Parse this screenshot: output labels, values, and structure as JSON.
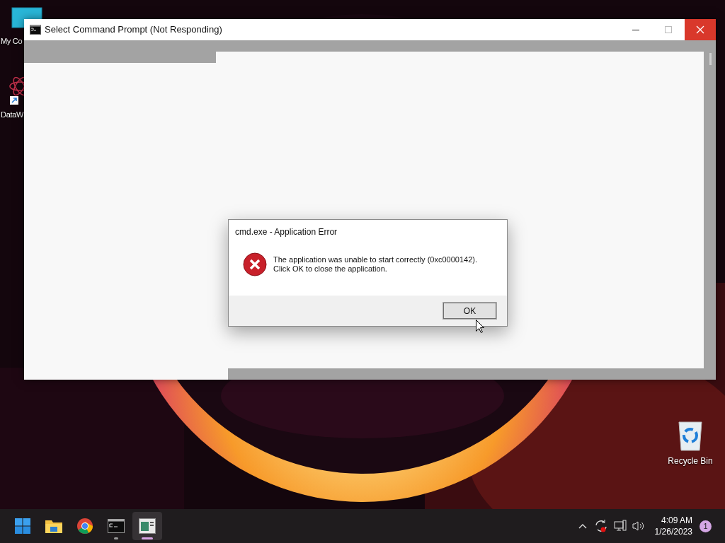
{
  "desktop_icons": [
    {
      "kind": "computer",
      "label": "My Co"
    },
    {
      "kind": "app",
      "label": "DataW"
    },
    {
      "kind": "recycle",
      "label": "Recycle Bin"
    }
  ],
  "window": {
    "title": "Select Command Prompt (Not Responding)"
  },
  "dialog": {
    "title": "cmd.exe - Application Error",
    "message": [
      "The application was unable to start correctly (0xc0000142).",
      "Click OK to close the application."
    ],
    "button": "OK"
  },
  "taskbar": {
    "apps": [
      {
        "kind": "start",
        "running": false,
        "selected": false
      },
      {
        "kind": "explorer",
        "running": false,
        "selected": false
      },
      {
        "kind": "chrome",
        "running": false,
        "selected": false
      },
      {
        "kind": "terminal",
        "running": true,
        "selected": false
      },
      {
        "kind": "appwindow",
        "running": true,
        "selected": true
      }
    ],
    "time": "4:09 AM",
    "date": "1/26/2023",
    "notification_count": "1"
  }
}
